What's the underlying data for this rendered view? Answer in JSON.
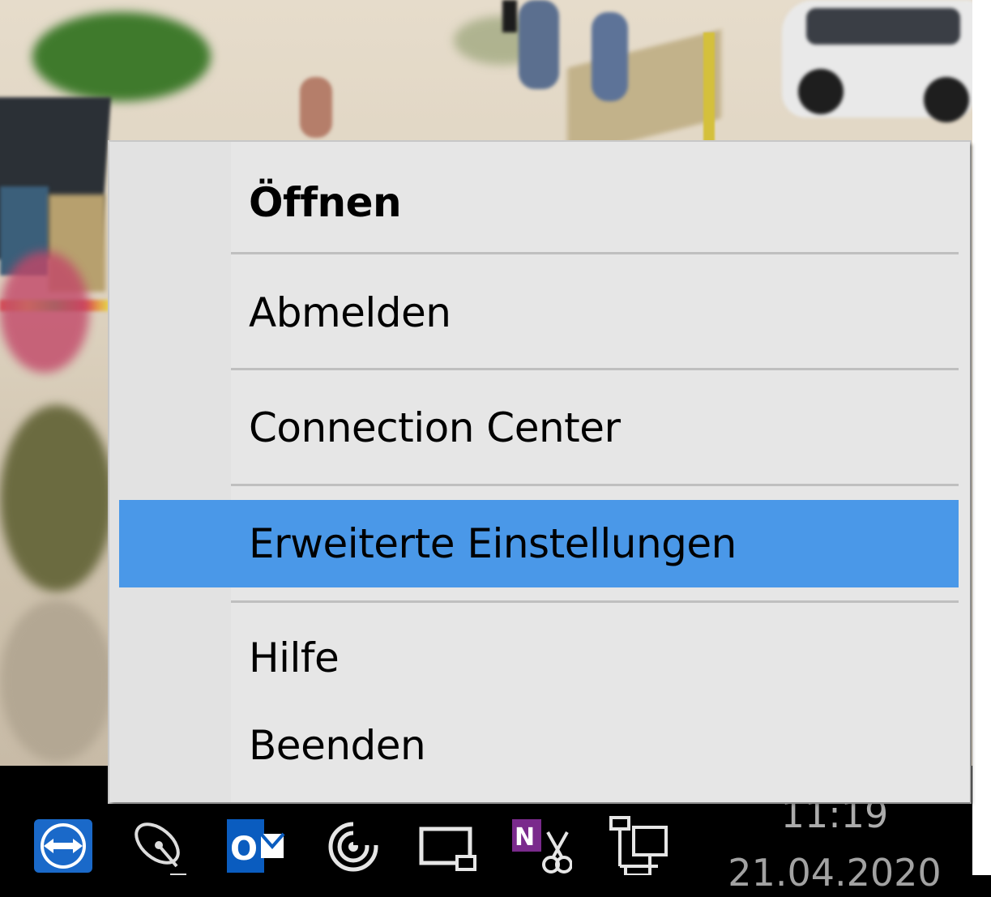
{
  "context_menu": {
    "items": [
      {
        "label": "Öffnen",
        "default": true
      },
      {
        "label": "Abmelden"
      },
      {
        "label": "Connection Center"
      },
      {
        "label": "Erweiterte Einstellungen",
        "highlighted": true
      },
      {
        "label": "Hilfe"
      },
      {
        "label": "Beenden"
      }
    ],
    "highlight_color": "#4a98e8"
  },
  "taskbar": {
    "tray_icons": [
      {
        "name": "teamviewer-icon"
      },
      {
        "name": "satellite-dish-icon"
      },
      {
        "name": "outlook-icon"
      },
      {
        "name": "spiral-app-icon"
      },
      {
        "name": "display-icon"
      },
      {
        "name": "onenote-clipper-icon"
      },
      {
        "name": "network-icon"
      }
    ],
    "clock": {
      "time": "11:19",
      "date": "21.04.2020"
    }
  }
}
